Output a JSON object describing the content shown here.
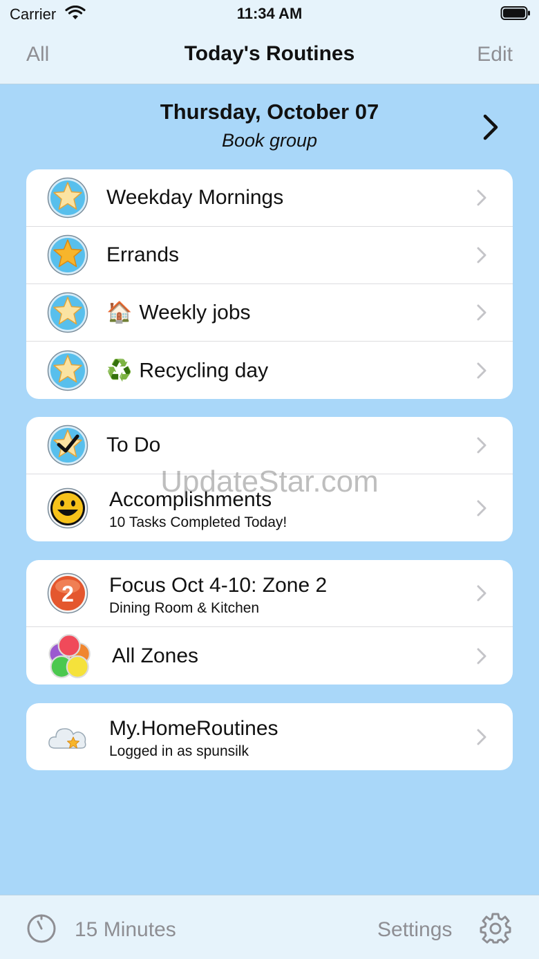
{
  "status_bar": {
    "carrier": "Carrier",
    "time": "11:34 AM"
  },
  "nav": {
    "left": "All",
    "title": "Today's Routines",
    "right": "Edit"
  },
  "header": {
    "date": "Thursday, October 07",
    "subtitle": "Book group"
  },
  "routines": [
    {
      "label": "Weekday Mornings",
      "emoji": "",
      "icon": "star-icon"
    },
    {
      "label": "Errands",
      "emoji": "",
      "icon": "star-icon"
    },
    {
      "label": "Weekly jobs",
      "emoji": "🏠",
      "icon": "star-icon"
    },
    {
      "label": "Recycling day",
      "emoji": "♻️",
      "icon": "star-icon"
    }
  ],
  "tasks": {
    "todo": {
      "label": "To Do",
      "icon": "checked-star-icon"
    },
    "accomplishments": {
      "label": "Accomplishments",
      "detail": "10 Tasks Completed Today!",
      "icon": "smiley-icon"
    }
  },
  "zones": {
    "focus": {
      "label": "Focus Oct 4-10: Zone 2",
      "detail": "Dining Room & Kitchen",
      "badge": "2",
      "icon": "zone-badge-icon"
    },
    "all": {
      "label": "All Zones",
      "icon": "zones-icon"
    }
  },
  "account": {
    "label": "My.HomeRoutines",
    "detail": "Logged in as spunsilk",
    "icon": "cloud-icon"
  },
  "watermark": "UpdateStar.com",
  "toolbar": {
    "timer_label": "15 Minutes",
    "settings_label": "Settings"
  },
  "colors": {
    "background": "#a9d7f9",
    "bar": "#e6f3fb",
    "inactive_text": "#8e8e93",
    "star": "#f7b52b"
  }
}
